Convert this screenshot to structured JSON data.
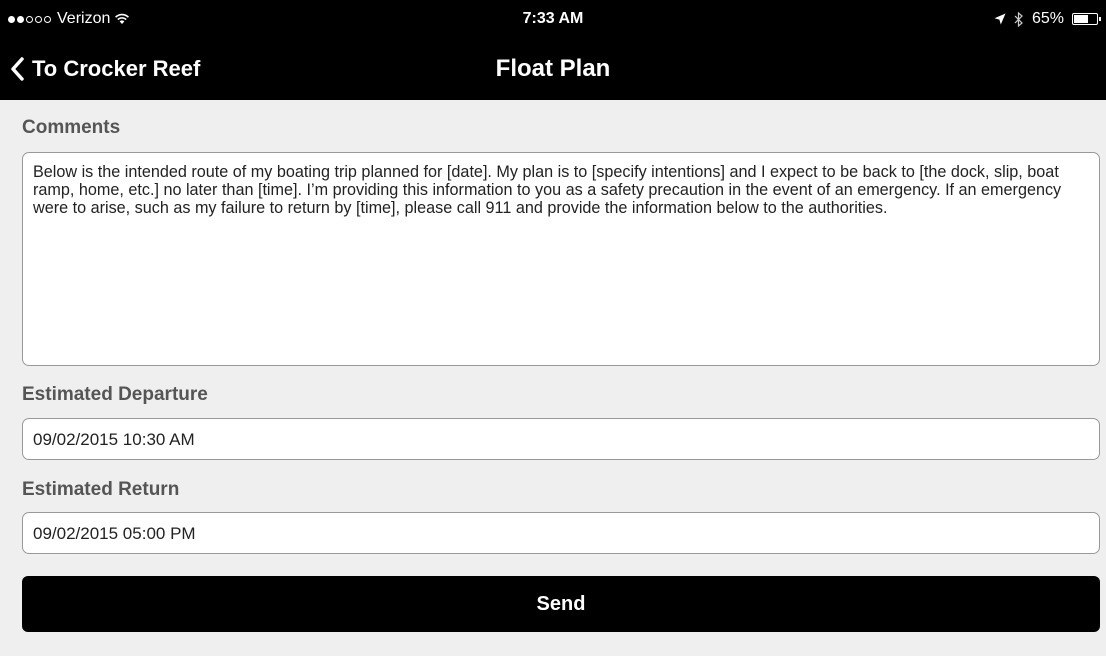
{
  "status_bar": {
    "carrier": "Verizon",
    "signal_bars_filled": 2,
    "signal_bars_total": 5,
    "time": "7:33 AM",
    "battery_percent_label": "65%",
    "battery_level": 0.65,
    "icons": [
      "wifi-icon",
      "location-arrow-icon",
      "bluetooth-icon",
      "battery-icon"
    ]
  },
  "nav": {
    "back_label": "To Crocker Reef",
    "title": "Float Plan"
  },
  "form": {
    "comments_label": "Comments",
    "comments_value": "Below is the intended route of my boating trip planned for [date].  My plan is to [specify intentions] and I expect to be back to [the dock, slip, boat ramp, home, etc.] no later than [time].  I’m providing this information to you as a safety precaution in the event of an emergency.  If an emergency were to arise, such as my failure to return by [time], please call 911 and provide the information below to the authorities.",
    "departure_label": "Estimated Departure",
    "departure_value": "09/02/2015 10:30 AM",
    "return_label": "Estimated Return",
    "return_value": "09/02/2015 05:00 PM",
    "send_label": "Send"
  },
  "colors": {
    "bar_background": "#000000",
    "page_background": "#efefef",
    "label_text": "#555555"
  }
}
